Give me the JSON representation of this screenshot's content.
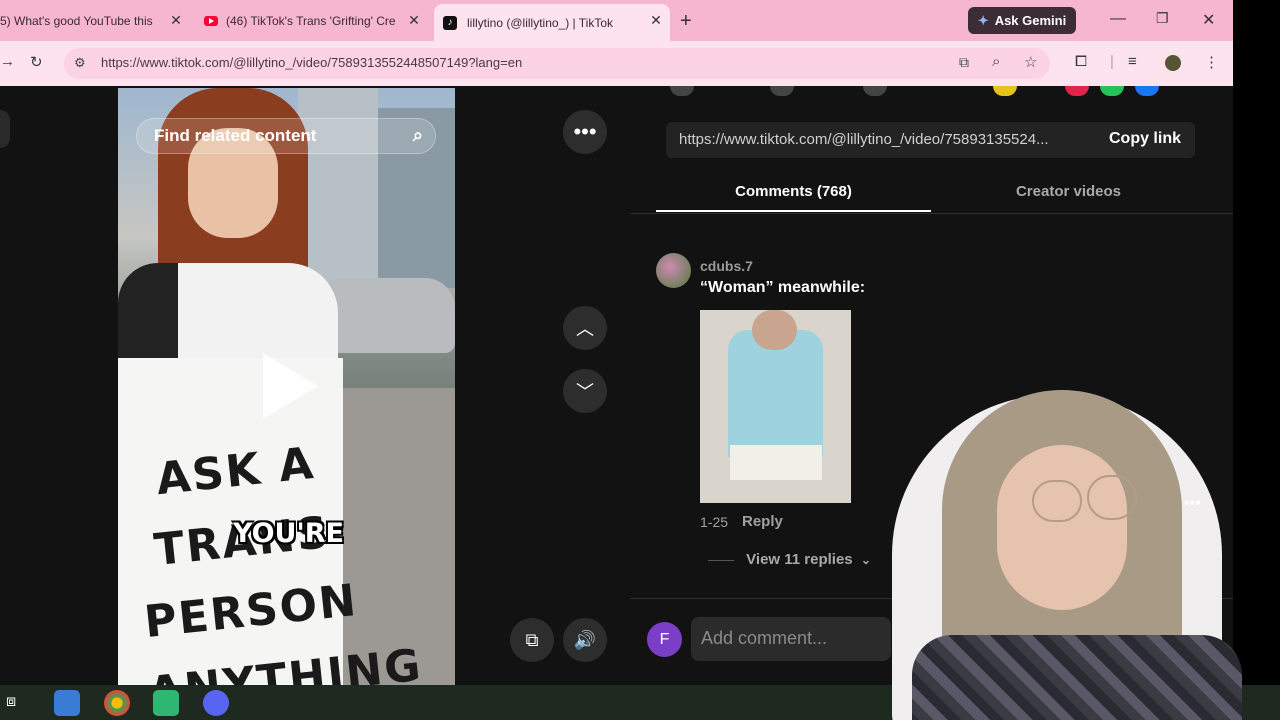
{
  "browser": {
    "tabs": [
      {
        "title": "5) What's good YouTube this",
        "icon": "youtube-icon"
      },
      {
        "title": "(46) TikTok's Trans 'Grifting' Cre",
        "icon": "youtube-icon"
      },
      {
        "title": "lillytino (@lillytino_) | TikTok",
        "icon": "tiktok-icon",
        "active": true
      }
    ],
    "gemini_label": "Ask Gemini",
    "url": "https://www.tiktok.com/@lillytino_/video/7589313552448507149?lang=en"
  },
  "video": {
    "find_related": "Find related content",
    "caption": "YOU'RE",
    "sign_lines": [
      "ASK A",
      "TRANS",
      "PERSON",
      "ANYTHING"
    ]
  },
  "panel": {
    "share_url": "https://www.tiktok.com/@lillytino_/video/75893135524...",
    "copy_link": "Copy link",
    "tab_comments": "Comments (768)",
    "tab_creator": "Creator videos",
    "comment": {
      "user": "cdubs.7",
      "text": "“Woman” meanwhile:",
      "date": "1-25",
      "reply": "Reply",
      "view_replies": "View 11 replies"
    },
    "user_initial": "F",
    "add_comment_placeholder": "Add comment..."
  },
  "colors": {
    "tab_strip": "#f7b6cf",
    "toolbar": "#fde3ee",
    "page_bg": "#121212",
    "user_avatar": "#7b3fc7"
  }
}
